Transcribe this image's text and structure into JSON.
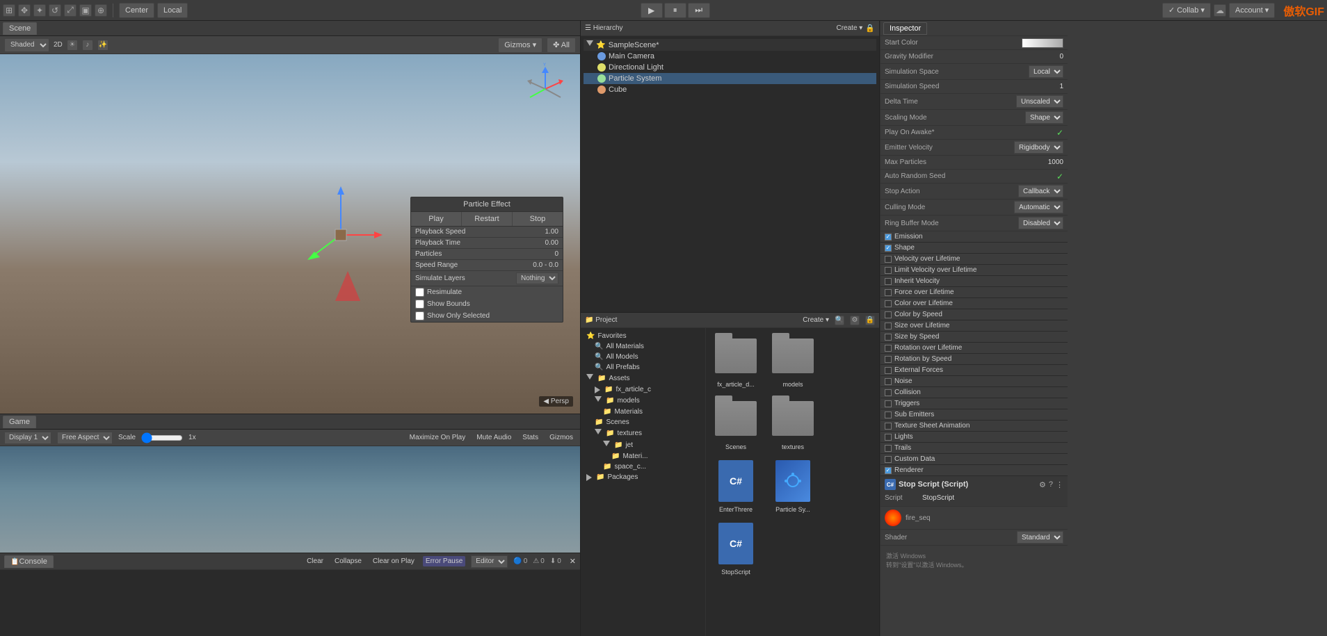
{
  "topbar": {
    "tabs": [
      "Scene",
      "Game"
    ],
    "center_label": "Center",
    "local_label": "Local",
    "play_label": "▶",
    "pause_label": "⏸",
    "step_label": "⏭",
    "collab_label": "✓ Collab ▾",
    "account_label": "Account ▾",
    "logo_text": "傲软GIF"
  },
  "scene": {
    "tab": "Scene",
    "shading_mode": "Shaded",
    "gizmos_label": "Gizmos ▾",
    "all_label": "✤ All",
    "persp_label": "◀ Persp"
  },
  "particle_effect": {
    "title": "Particle Effect",
    "play_btn": "Play",
    "restart_btn": "Restart",
    "stop_btn": "Stop",
    "rows": [
      {
        "label": "Playback Speed",
        "value": "1.00"
      },
      {
        "label": "Playback Time",
        "value": "0.00"
      },
      {
        "label": "Particles",
        "value": "0"
      },
      {
        "label": "Speed Range",
        "value": "0.0 - 0.0"
      },
      {
        "label": "Simulate Layers",
        "value": "Nothing",
        "dropdown": true
      }
    ],
    "resimulate_label": "Resimulate",
    "show_bounds_label": "Show Bounds",
    "show_only_selected_label": "Show Only Selected"
  },
  "game": {
    "tab": "Game",
    "display_label": "Display 1",
    "aspect_label": "Free Aspect",
    "scale_label": "Scale",
    "scale_value": "1x",
    "maximize_label": "Maximize On Play",
    "mute_label": "Mute Audio",
    "stats_label": "Stats",
    "gizmos_label": "Gizmos"
  },
  "console": {
    "tab": "Console",
    "clear_btn": "Clear",
    "collapse_btn": "Collapse",
    "clear_on_play_btn": "Clear on Play",
    "error_pause_btn": "Error Pause",
    "editor_dropdown": "Editor ▾",
    "error_count": "0",
    "warning_count": "0",
    "info_count": "0"
  },
  "hierarchy": {
    "tab": "Hierarchy",
    "create_label": "Create ▾",
    "scene_name": "SampleScene*",
    "items": [
      {
        "label": "Main Camera",
        "icon": "camera",
        "indent": 1
      },
      {
        "label": "Directional Light",
        "icon": "light",
        "indent": 1
      },
      {
        "label": "Particle System",
        "icon": "particle",
        "indent": 1,
        "selected": true
      },
      {
        "label": "Cube",
        "icon": "cube",
        "indent": 1
      }
    ]
  },
  "project": {
    "tab": "Project",
    "create_label": "Create ▾",
    "tree": [
      {
        "label": "Favorites",
        "indent": 0,
        "star": true
      },
      {
        "label": "All Materials",
        "indent": 1,
        "search": true
      },
      {
        "label": "All Models",
        "indent": 1,
        "search": true
      },
      {
        "label": "All Prefabs",
        "indent": 1,
        "search": true
      },
      {
        "label": "Assets",
        "indent": 0,
        "folder": true
      },
      {
        "label": "fx_article_c",
        "indent": 1,
        "folder": true
      },
      {
        "label": "models",
        "indent": 1,
        "folder": true
      },
      {
        "label": "Materials",
        "indent": 2,
        "folder": true
      },
      {
        "label": "Scenes",
        "indent": 1,
        "folder": true
      },
      {
        "label": "textures",
        "indent": 1,
        "folder": true
      },
      {
        "label": "jet",
        "indent": 2,
        "folder": true
      },
      {
        "label": "Materi...",
        "indent": 3,
        "folder": true
      },
      {
        "label": "space_c...",
        "indent": 2,
        "folder": true
      },
      {
        "label": "Packages",
        "indent": 0,
        "folder": true
      }
    ],
    "assets": [
      {
        "label": "fx_article_d...",
        "type": "folder"
      },
      {
        "label": "models",
        "type": "folder"
      },
      {
        "label": "Scenes",
        "type": "folder"
      },
      {
        "label": "textures",
        "type": "folder"
      },
      {
        "label": "EnterThrere",
        "type": "csharp"
      },
      {
        "label": "Particle Sy...",
        "type": "particle"
      },
      {
        "label": "StopScript",
        "type": "csharp"
      }
    ]
  },
  "inspector": {
    "tab": "Inspector",
    "properties": [
      {
        "label": "Start Color",
        "value": "",
        "type": "color"
      },
      {
        "label": "Gravity Modifier",
        "value": "0",
        "type": "number"
      },
      {
        "label": "Simulation Space",
        "value": "Local",
        "type": "dropdown"
      },
      {
        "label": "Simulation Speed",
        "value": "1",
        "type": "number"
      },
      {
        "label": "Delta Time",
        "value": "Unscaled",
        "type": "dropdown"
      },
      {
        "label": "Scaling Mode",
        "value": "Shape",
        "type": "dropdown"
      },
      {
        "label": "Play On Awake*",
        "value": "✓",
        "type": "check"
      },
      {
        "label": "Emitter Velocity",
        "value": "Rigidbody",
        "type": "dropdown"
      },
      {
        "label": "Max Particles",
        "value": "1000",
        "type": "number"
      },
      {
        "label": "Auto Random Seed",
        "value": "✓",
        "type": "check"
      },
      {
        "label": "Stop Action",
        "value": "Callback",
        "type": "dropdown"
      },
      {
        "label": "Culling Mode",
        "value": "Automatic",
        "type": "dropdown"
      },
      {
        "label": "Ring Buffer Mode",
        "value": "Disabled",
        "type": "dropdown"
      }
    ],
    "checkboxes": [
      {
        "label": "Emission",
        "checked": true
      },
      {
        "label": "Shape",
        "checked": true
      },
      {
        "label": "Velocity over Lifetime",
        "checked": false
      },
      {
        "label": "Limit Velocity over Lifetime",
        "checked": false
      },
      {
        "label": "Inherit Velocity",
        "checked": false
      },
      {
        "label": "Force over Lifetime",
        "checked": false
      },
      {
        "label": "Color over Lifetime",
        "checked": false
      },
      {
        "label": "Color by Speed",
        "checked": false
      },
      {
        "label": "Size over Lifetime",
        "checked": false
      },
      {
        "label": "Size by Speed",
        "checked": false
      },
      {
        "label": "Rotation over Lifetime",
        "checked": false
      },
      {
        "label": "Rotation by Speed",
        "checked": false
      },
      {
        "label": "External Forces",
        "checked": false
      },
      {
        "label": "Noise",
        "checked": false
      },
      {
        "label": "Collision",
        "checked": false
      },
      {
        "label": "Triggers",
        "checked": false
      },
      {
        "label": "Sub Emitters",
        "checked": false
      },
      {
        "label": "Texture Sheet Animation",
        "checked": false
      },
      {
        "label": "Lights",
        "checked": false
      },
      {
        "label": "Trails",
        "checked": false
      },
      {
        "label": "Custom Data",
        "checked": false
      },
      {
        "label": "Renderer",
        "checked": true
      }
    ],
    "stop_script": {
      "title": "Stop Script (Script)",
      "script_label": "Script",
      "script_value": "StopScript",
      "fire_seq_label": "fire_seq",
      "shader_label": "Shader",
      "shader_value": "Standard"
    }
  }
}
